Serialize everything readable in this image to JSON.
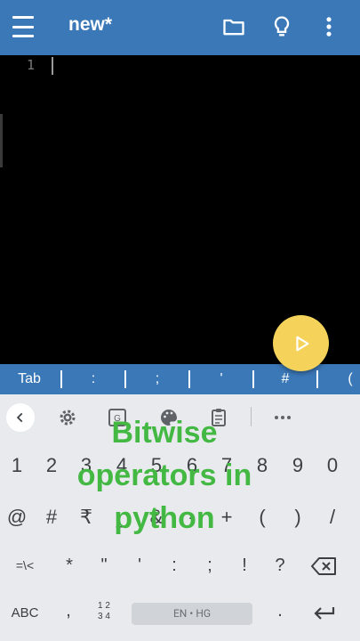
{
  "app_bar": {
    "title": "new*",
    "icons": [
      "menu-icon",
      "folder-icon",
      "lightbulb-icon",
      "more-vert-icon"
    ]
  },
  "editor": {
    "line_number": "1"
  },
  "symbol_bar": {
    "keys": [
      "Tab",
      ":",
      ";",
      "'",
      "#",
      "("
    ]
  },
  "keyboard": {
    "toolbar_icons": [
      "back-icon",
      "settings-icon",
      "translate-icon",
      "palette-icon",
      "clipboard-icon",
      "more-icon"
    ],
    "number_row": [
      "1",
      "2",
      "3",
      "4",
      "5",
      "6",
      "7",
      "8",
      "9",
      "0"
    ],
    "symbol_row1": [
      "@",
      "#",
      "₹",
      "_",
      "&",
      "-",
      "+",
      "(",
      ")",
      "/"
    ],
    "symbol_row2": [
      "=\\<",
      "*",
      "\"",
      "'",
      ":",
      ";",
      "!",
      "?"
    ],
    "abc_label": "ABC",
    "comma": ",",
    "numpad_top": "1 2",
    "numpad_bottom": "3 4",
    "space_label": "EN • HG",
    "period": "."
  },
  "overlay": {
    "line1": "Bitwise",
    "line2": "operators in",
    "line3": "python"
  },
  "colors": {
    "app_bar": "#3b78b8",
    "fab": "#f5d25a",
    "overlay_text": "#43b843"
  }
}
